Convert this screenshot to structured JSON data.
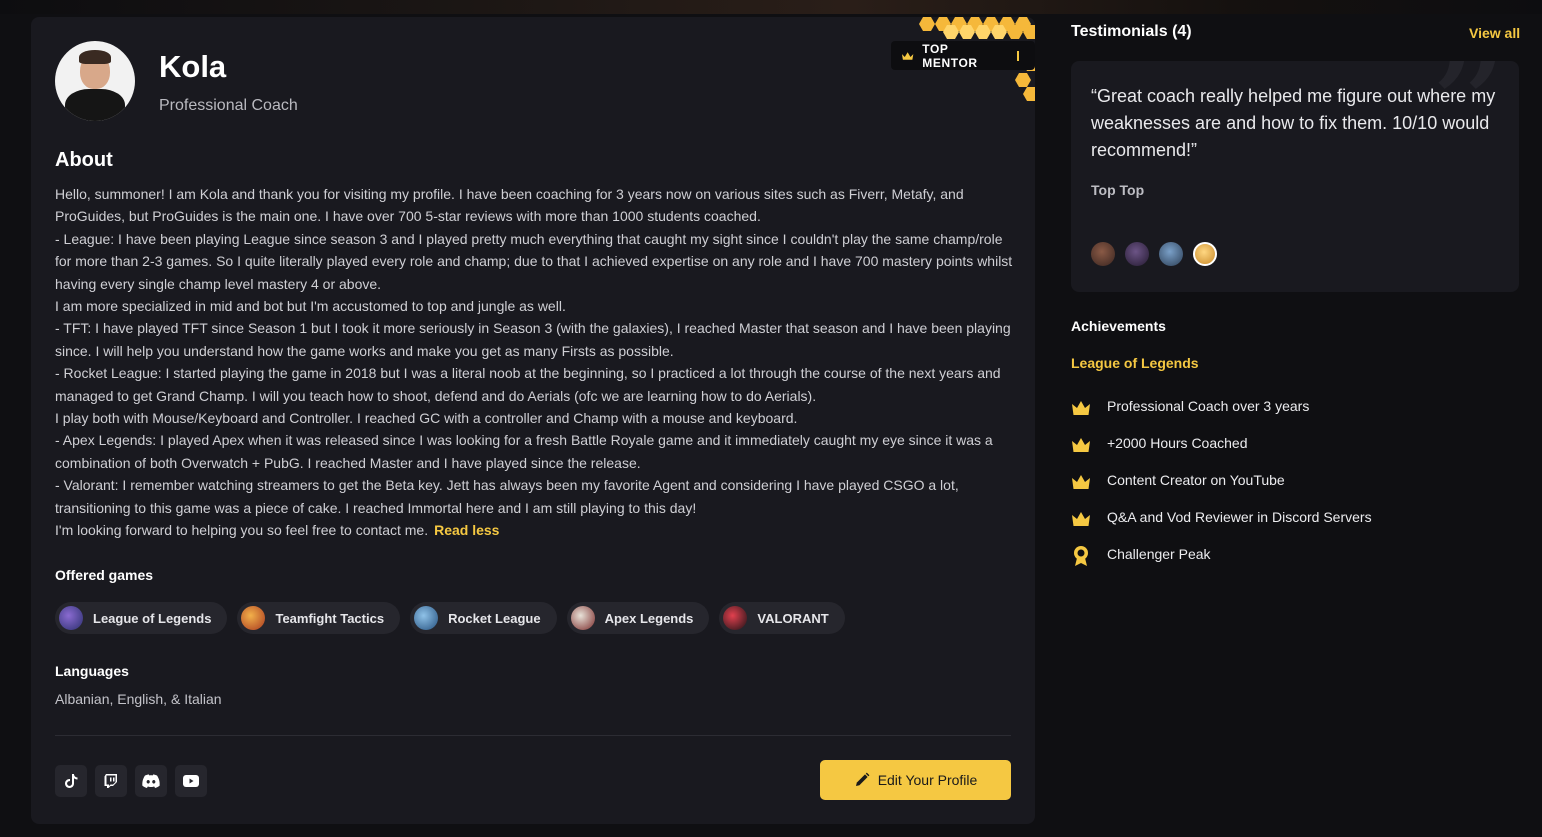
{
  "profile": {
    "name": "Kola",
    "role": "Professional Coach",
    "badge": "TOP MENTOR"
  },
  "about": {
    "title": "About",
    "paragraphs": [
      "Hello, summoner! I am Kola and thank you for visiting my profile. I have been coaching for 3 years now on various sites such as Fiverr, Metafy, and ProGuides, but ProGuides is the main one. I have over 700 5-star reviews with more than 1000 students coached.",
      "- League: I have been playing League since season 3 and I played pretty much everything that caught my sight since I couldn't play the same champ/role for more than 2-3 games. So I quite literally played every role and champ; due to that I achieved expertise on any role and I have 700 mastery points whilst having every single champ level mastery 4 or above.",
      "I am more specialized in mid and bot but I'm accustomed to top and jungle as well.",
      "- TFT: I have played TFT since Season 1 but I took it more seriously in Season 3 (with the galaxies), I reached Master that season and I have been playing since. I will help you understand how the game works and make you get as many Firsts as possible.",
      "- Rocket League: I started playing the game in 2018 but I was a literal noob at the beginning, so I practiced a lot through the course of the next years and managed to get Grand Champ. I will you teach how to shoot, defend and do Aerials (ofc we are learning how to do Aerials).",
      "I play both with Mouse/Keyboard and Controller. I reached GC with a controller and Champ with a mouse and keyboard.",
      "- Apex Legends: I played Apex when it was released since I was looking for a fresh Battle Royale game and it immediately caught my eye since it was a combination of both Overwatch + PubG. I reached Master and I have played since the release.",
      "- Valorant: I remember watching streamers to get the Beta key. Jett has always been my favorite Agent and considering I have played CSGO a lot, transitioning to this game was a piece of cake. I reached Immortal here and I am still playing to this day!",
      "I'm looking forward to helping you so feel free to contact me."
    ],
    "read_less": "Read less"
  },
  "offered_games": {
    "title": "Offered games",
    "items": [
      {
        "label": "League of Legends",
        "color": "#3b3f8c"
      },
      {
        "label": "Teamfight Tactics",
        "color": "#c4562a"
      },
      {
        "label": "Rocket League",
        "color": "#2f6fa8"
      },
      {
        "label": "Apex Legends",
        "color": "#a43a3a"
      },
      {
        "label": "VALORANT",
        "color": "#2a1a1e"
      }
    ]
  },
  "languages": {
    "title": "Languages",
    "value": "Albanian, English, & Italian"
  },
  "socials": [
    "tiktok-icon",
    "twitch-icon",
    "discord-icon",
    "youtube-icon"
  ],
  "edit_button": "Edit Your Profile",
  "testimonials": {
    "title": "Testimonials (4)",
    "view_all": "View all",
    "quote": "“Great coach really helped me figure out where my weaknesses are and how to fix them. 10/10 would recommend!”",
    "reviewer": "Top Top",
    "avatars": [
      {
        "color": "#5a3a2e"
      },
      {
        "color": "#3c2d48"
      },
      {
        "color": "#3e5b7a"
      },
      {
        "color": "#e0a83a"
      }
    ],
    "active_index": 3
  },
  "achievements": {
    "title": "Achievements",
    "game": "League of Legends",
    "items": [
      {
        "label": "Professional Coach over 3 years",
        "icon": "crown-icon"
      },
      {
        "label": "+2000 Hours Coached",
        "icon": "crown-icon"
      },
      {
        "label": "Content Creator on YouTube",
        "icon": "crown-icon"
      },
      {
        "label": "Q&A and Vod Reviewer in Discord Servers",
        "icon": "crown-icon"
      },
      {
        "label": "Challenger Peak",
        "icon": "medal-icon"
      }
    ]
  },
  "colors": {
    "accent": "#f5c842",
    "card": "#19191f",
    "background": "#0f0f12"
  }
}
